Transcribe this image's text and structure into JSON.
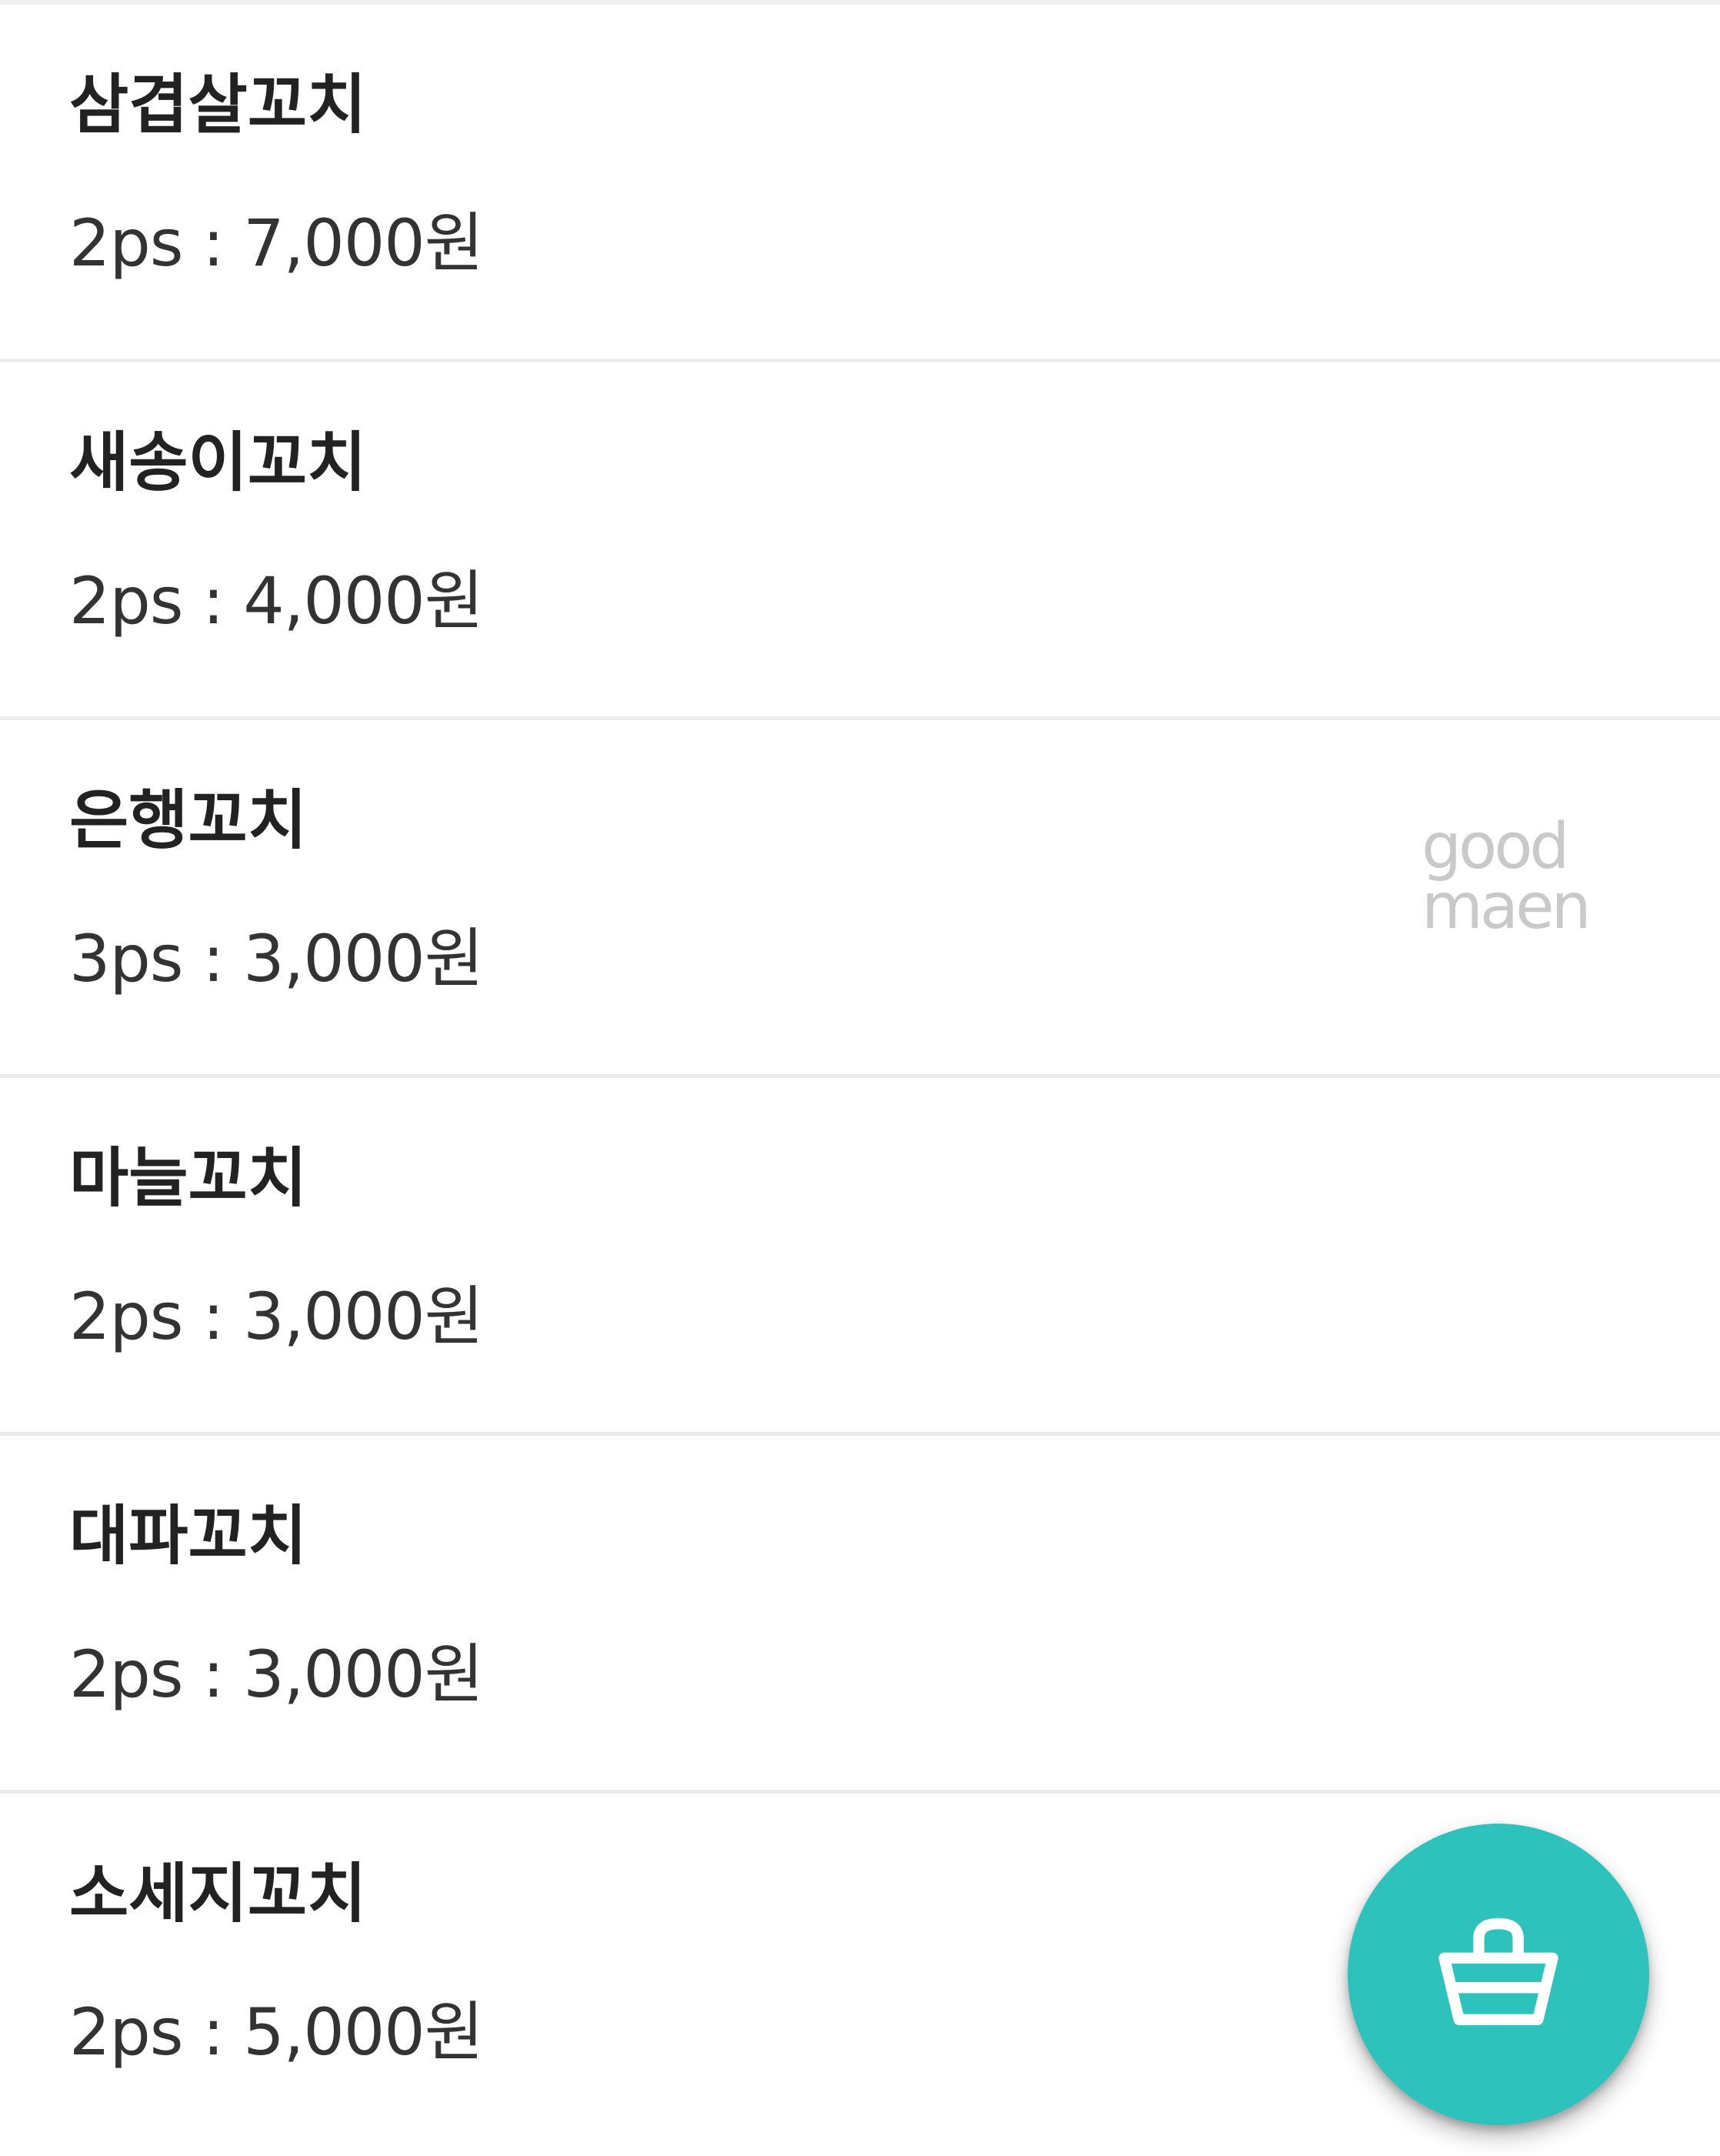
{
  "menu": {
    "items": [
      {
        "name": "삼겹살꼬치",
        "price": "2ps : 7,000원"
      },
      {
        "name": "새송이꼬치",
        "price": "2ps : 4,000원"
      },
      {
        "name": "은행꼬치",
        "price": "3ps : 3,000원"
      },
      {
        "name": "마늘꼬치",
        "price": "2ps : 3,000원"
      },
      {
        "name": "대파꼬치",
        "price": "2ps : 3,000원"
      },
      {
        "name": "소세지꼬치",
        "price": "2ps : 5,000원"
      }
    ]
  },
  "watermark": {
    "line1": "good",
    "line2": "maen"
  },
  "cart_button": {
    "icon": "shopping-basket-icon",
    "color": "#2ec2bd",
    "icon_color": "#ffffff"
  }
}
